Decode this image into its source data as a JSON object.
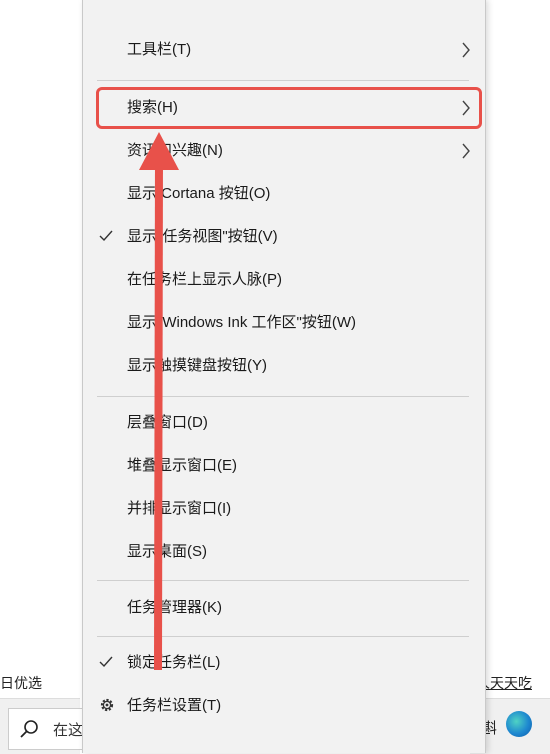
{
  "background": {
    "left_text": "日优选",
    "right_text": "人天天吃",
    "search_placeholder": "在这",
    "taskbar_char": "斟"
  },
  "menu": {
    "items": [
      {
        "label": "工具栏(T)",
        "submenu": true
      },
      {
        "label": "搜索(H)",
        "submenu": true,
        "highlighted": true
      },
      {
        "label": "资讯和兴趣(N)",
        "submenu": true
      },
      {
        "label": "显示 Cortana 按钮(O)"
      },
      {
        "label": "显示\"任务视图\"按钮(V)",
        "checked": true
      },
      {
        "label": "在任务栏上显示人脉(P)"
      },
      {
        "label": "显示\"Windows Ink 工作区\"按钮(W)"
      },
      {
        "label": "显示触摸键盘按钮(Y)"
      },
      {
        "label": "层叠窗口(D)"
      },
      {
        "label": "堆叠显示窗口(E)"
      },
      {
        "label": "并排显示窗口(I)"
      },
      {
        "label": "显示桌面(S)"
      },
      {
        "label": "任务管理器(K)"
      },
      {
        "label": "锁定任务栏(L)",
        "checked": true
      },
      {
        "label": "任务栏设置(T)",
        "icon": "gear-icon"
      }
    ]
  },
  "colors": {
    "highlight": "#e8514a",
    "arrow": "#e8514a",
    "menu_bg": "#f2f2f2"
  }
}
